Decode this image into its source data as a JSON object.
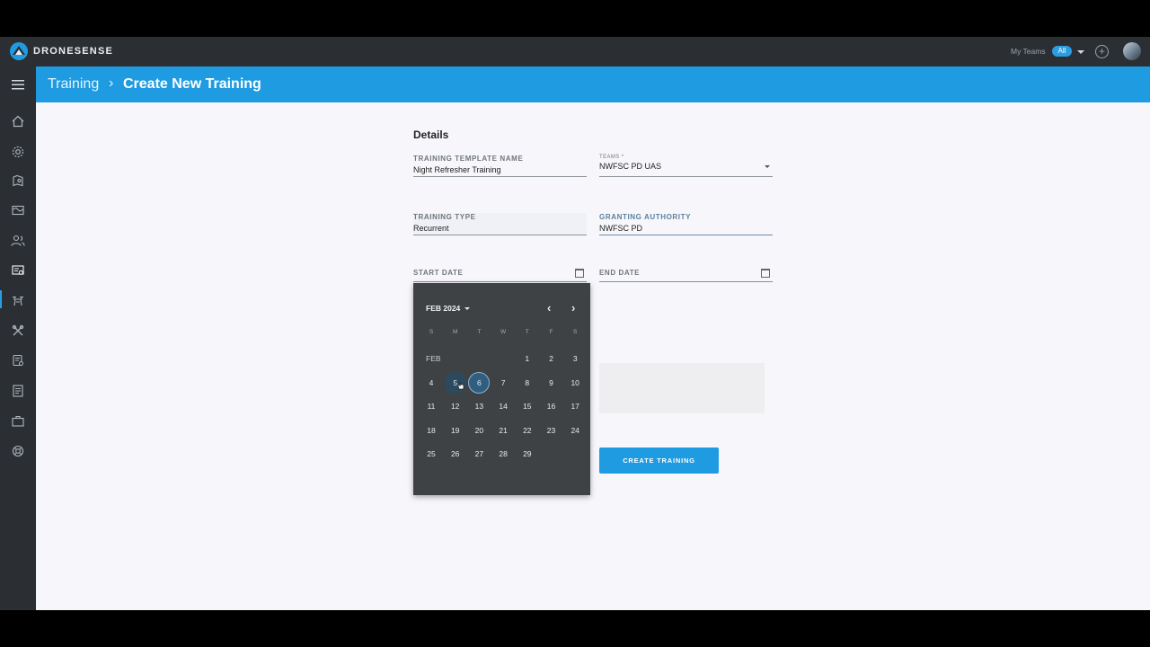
{
  "app": {
    "name": "DRONESENSE",
    "brand_color": "#1f9be2"
  },
  "topbar": {
    "my_teams_label": "My Teams",
    "teams_filter": "All"
  },
  "sidebar": {
    "items": [
      {
        "icon": "home-icon"
      },
      {
        "icon": "settings-gear-icon"
      },
      {
        "icon": "map-pin-icon"
      },
      {
        "icon": "map-icon"
      },
      {
        "icon": "people-icon"
      },
      {
        "icon": "training-certificate-icon"
      },
      {
        "icon": "drone-icon"
      },
      {
        "icon": "tools-icon"
      },
      {
        "icon": "badge-icon"
      },
      {
        "icon": "document-icon"
      },
      {
        "icon": "briefcase-icon"
      },
      {
        "icon": "support-icon"
      }
    ],
    "active_item": "training-certificate-icon"
  },
  "breadcrumb": {
    "parent": "Training",
    "current": "Create New Training"
  },
  "form": {
    "section_title": "Details",
    "template_name": {
      "label": "TRAINING TEMPLATE NAME",
      "value": "Night Refresher Training"
    },
    "teams": {
      "label": "TEAMS *",
      "value": "NWFSC PD UAS"
    },
    "training_type": {
      "label": "TRAINING TYPE",
      "value": "Recurrent"
    },
    "granting_authority": {
      "label": "GRANTING AUTHORITY",
      "value": "NWFSC PD"
    },
    "start_date": {
      "label": "START DATE",
      "value": ""
    },
    "end_date": {
      "label": "END DATE",
      "value": ""
    },
    "submit_label": "CREATE TRAINING"
  },
  "calendar": {
    "month_label": "FEB 2024",
    "month_short": "FEB",
    "weekday_headers": [
      "S",
      "M",
      "T",
      "W",
      "T",
      "F",
      "S"
    ],
    "first_weekday_index": 4,
    "days": [
      "1",
      "2",
      "3",
      "4",
      "5",
      "6",
      "7",
      "8",
      "9",
      "10",
      "11",
      "12",
      "13",
      "14",
      "15",
      "16",
      "17",
      "18",
      "19",
      "20",
      "21",
      "22",
      "23",
      "24",
      "25",
      "26",
      "27",
      "28",
      "29"
    ],
    "selected_day": "6",
    "hovered_day": "5"
  }
}
